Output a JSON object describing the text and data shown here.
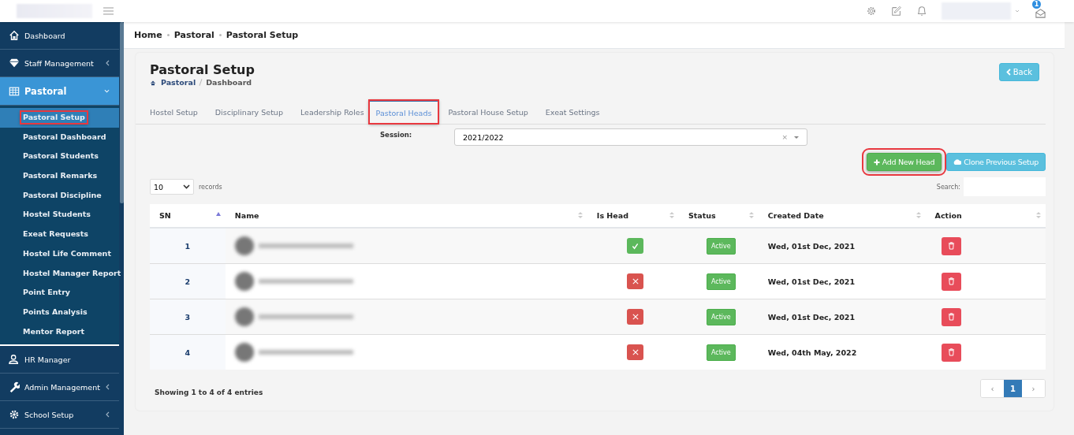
{
  "topbar": {
    "notification_count": "1"
  },
  "sidebar": {
    "items": [
      {
        "label": "Dashboard",
        "kind": "link",
        "expanded": false
      },
      {
        "label": "Staff Management",
        "kind": "group",
        "expanded": false
      },
      {
        "label": "Pastoral",
        "kind": "group",
        "expanded": true,
        "children": [
          {
            "label": "Pastoral Setup",
            "selected": true,
            "annotated": true
          },
          {
            "label": "Pastoral Dashboard",
            "selected": false,
            "annotated": false
          },
          {
            "label": "Pastoral Students",
            "selected": false,
            "annotated": false
          },
          {
            "label": "Pastoral Remarks",
            "selected": false,
            "annotated": false
          },
          {
            "label": "Pastoral Discipline",
            "selected": false,
            "annotated": false
          },
          {
            "label": "Hostel Students",
            "selected": false,
            "annotated": false
          },
          {
            "label": "Exeat Requests",
            "selected": false,
            "annotated": false
          },
          {
            "label": "Hostel Life Comment",
            "selected": false,
            "annotated": false
          },
          {
            "label": "Hostel Manager Report",
            "selected": false,
            "annotated": false
          },
          {
            "label": "Point Entry",
            "selected": false,
            "annotated": false
          },
          {
            "label": "Points Analysis",
            "selected": false,
            "annotated": false
          },
          {
            "label": "Mentor Report",
            "selected": false,
            "annotated": false
          }
        ]
      },
      {
        "label": "HR Manager",
        "kind": "link",
        "expanded": false
      },
      {
        "label": "Admin Management",
        "kind": "group",
        "expanded": false
      },
      {
        "label": "School Setup",
        "kind": "group",
        "expanded": false
      }
    ]
  },
  "breadcrumb": [
    "Home",
    "Pastoral",
    "Pastoral Setup"
  ],
  "page": {
    "title": "Pastoral Setup",
    "crumbs": [
      "Pastoral",
      "Dashboard"
    ],
    "back_button": "Back"
  },
  "tabs": [
    {
      "label": "Hostel Setup",
      "selected": false,
      "annotated": false
    },
    {
      "label": "Disciplinary Setup",
      "selected": false,
      "annotated": false
    },
    {
      "label": "Leadership Roles",
      "selected": false,
      "annotated": false
    },
    {
      "label": "Pastoral Heads",
      "selected": true,
      "annotated": true
    },
    {
      "label": "Pastoral House Setup",
      "selected": false,
      "annotated": false
    },
    {
      "label": "Exeat Settings",
      "selected": false,
      "annotated": false
    }
  ],
  "session": {
    "label": "Session:",
    "value": "2021/2022",
    "clear": "×"
  },
  "actions": [
    {
      "label": "Add New Head",
      "kind": "add",
      "annotated": true
    },
    {
      "label": "Clone Previous Setup",
      "kind": "clone",
      "annotated": false
    }
  ],
  "table_controls": {
    "page_length": "10",
    "length_label": "records",
    "search_label": "Search:"
  },
  "table": {
    "columns": [
      {
        "label": "SN",
        "sorted": true
      },
      {
        "label": "Name",
        "sorted": false
      },
      {
        "label": "Is Head",
        "sorted": false
      },
      {
        "label": "Status",
        "sorted": false
      },
      {
        "label": "Created Date",
        "sorted": false
      },
      {
        "label": "Action",
        "sorted": false
      }
    ],
    "rows": [
      {
        "sn": "1",
        "is_head": true,
        "status": "Active",
        "created": "Wed, 01st Dec, 2021"
      },
      {
        "sn": "2",
        "is_head": false,
        "status": "Active",
        "created": "Wed, 01st Dec, 2021"
      },
      {
        "sn": "3",
        "is_head": false,
        "status": "Active",
        "created": "Wed, 01st Dec, 2021"
      },
      {
        "sn": "4",
        "is_head": false,
        "status": "Active",
        "created": "Wed, 04th May, 2022"
      }
    ]
  },
  "footer": {
    "info": "Showing 1 to 4 of 4 entries",
    "pages": [
      {
        "label": "‹",
        "selected": false
      },
      {
        "label": "1",
        "selected": true
      },
      {
        "label": "›",
        "selected": false
      }
    ]
  }
}
